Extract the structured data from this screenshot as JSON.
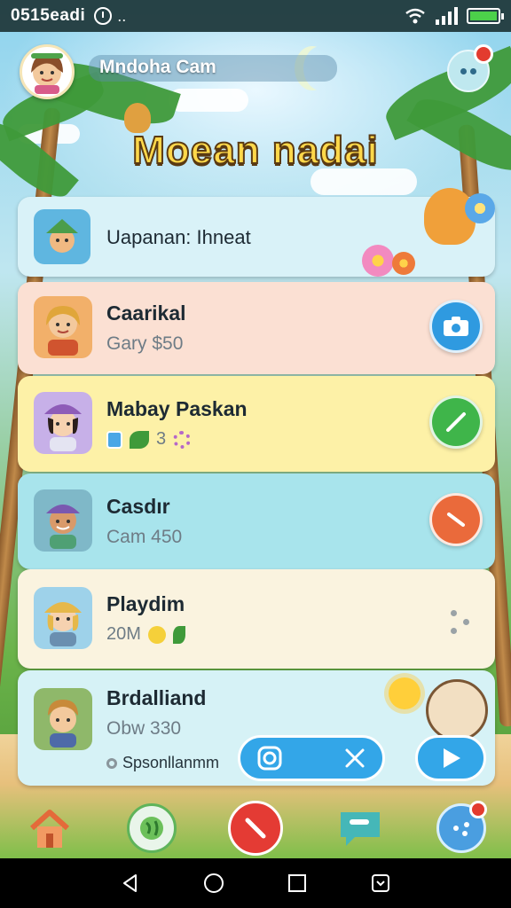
{
  "status_bar": {
    "time": "0515eadi",
    "icons": [
      "clock-icon",
      "wifi-icon",
      "signal-icon",
      "battery-icon"
    ]
  },
  "header": {
    "user_name": "Mndoha Cam",
    "title": "Moean nadai"
  },
  "top_card": {
    "label": "Uapanan: Ihneat"
  },
  "contacts": [
    {
      "name": "Caarikal",
      "sub": "Gary $50",
      "action_icon": "camera-icon",
      "color": "#2f9ae0"
    },
    {
      "name": "Mabay Paskan",
      "sub": "3",
      "action_icon": "pencil-icon",
      "color": "#3fb54a"
    },
    {
      "name": "Casdır",
      "sub": "Cam 450",
      "action_icon": "decline-icon",
      "color": "#ea6a3b"
    },
    {
      "name": "Playdim",
      "sub": "20M",
      "action_icon": "more-icon",
      "color": "#f6f1e4"
    },
    {
      "name": "Brdalliand",
      "sub": "Obw 330",
      "extra": "Spsonllanmm",
      "action_icon": "star-icon",
      "color": "#f0e3cc"
    }
  ],
  "bottom_nav": [
    "home-icon",
    "globe-icon",
    "call-end-icon",
    "chat-icon",
    "menu-icon"
  ],
  "system_nav": [
    "back-icon",
    "home-circle-icon",
    "recents-icon",
    "screenshot-icon"
  ]
}
